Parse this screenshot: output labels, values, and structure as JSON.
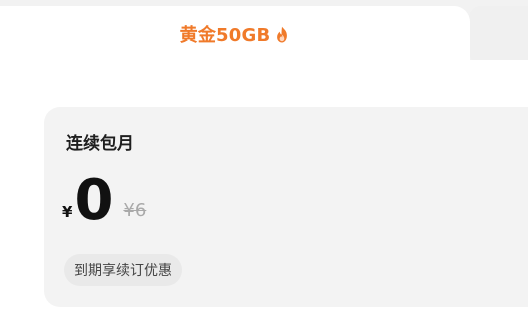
{
  "tabs": {
    "active_label": "黄金50GB"
  },
  "card": {
    "plan_title": "连续包月",
    "currency": "¥",
    "price": "0",
    "original_price": "¥6",
    "promo_text": "到期享续订优惠"
  },
  "colors": {
    "accent": "#f07a2a",
    "text_primary": "#1f1f1f",
    "text_muted": "#a9a9a9",
    "card_bg": "#f3f3f3"
  },
  "icons": {
    "tab_icon": "fire-icon"
  }
}
